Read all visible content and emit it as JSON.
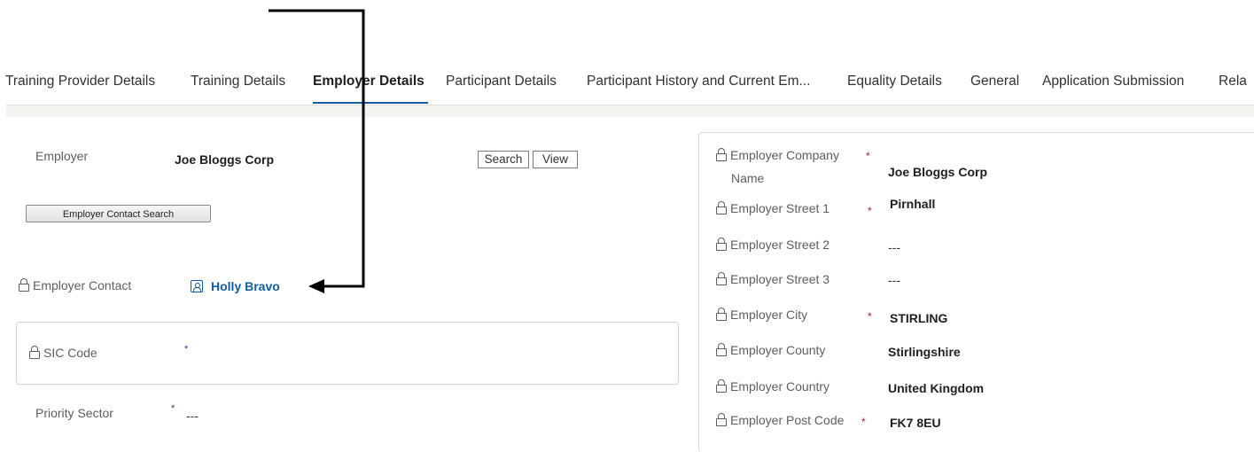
{
  "tabs": [
    {
      "label": "Training Provider Details"
    },
    {
      "label": "Training Details"
    },
    {
      "label": "Employer Details"
    },
    {
      "label": "Participant Details"
    },
    {
      "label": "Participant History and Current Em..."
    },
    {
      "label": "Equality Details"
    },
    {
      "label": "General"
    },
    {
      "label": "Application Submission"
    },
    {
      "label": "Rela"
    }
  ],
  "left": {
    "employer_label": "Employer",
    "employer_value": "Joe Bloggs Corp",
    "search_button": "Search",
    "view_button": "View",
    "contact_search_button": "Employer Contact Search",
    "contact_label": "Employer Contact",
    "contact_value": "Holly Bravo",
    "sic_label": "SIC Code",
    "sic_required": "*",
    "priority_label": "Priority Sector",
    "priority_required": "*",
    "priority_value": "---"
  },
  "right": {
    "rows": [
      {
        "label": "Employer Company Name",
        "label_line1": "Employer Company",
        "label_line2": "Name",
        "required": "*",
        "value": "Joe Bloggs Corp"
      },
      {
        "label": "Employer Street 1",
        "required": "*",
        "value": "Pirnhall"
      },
      {
        "label": "Employer Street 2",
        "required": "",
        "value": "---"
      },
      {
        "label": "Employer Street 3",
        "required": "",
        "value": "---"
      },
      {
        "label": "Employer City",
        "required": "*",
        "value": "STIRLING"
      },
      {
        "label": "Employer County",
        "required": "",
        "value": "Stirlingshire"
      },
      {
        "label": "Employer Country",
        "required": "",
        "value": "United Kingdom"
      },
      {
        "label": "Employer Post Code",
        "required": "*",
        "value": "FK7 8EU"
      }
    ]
  },
  "colors": {
    "accent": "#115ea3",
    "required": "#a4262c",
    "annotation": "#000000"
  }
}
